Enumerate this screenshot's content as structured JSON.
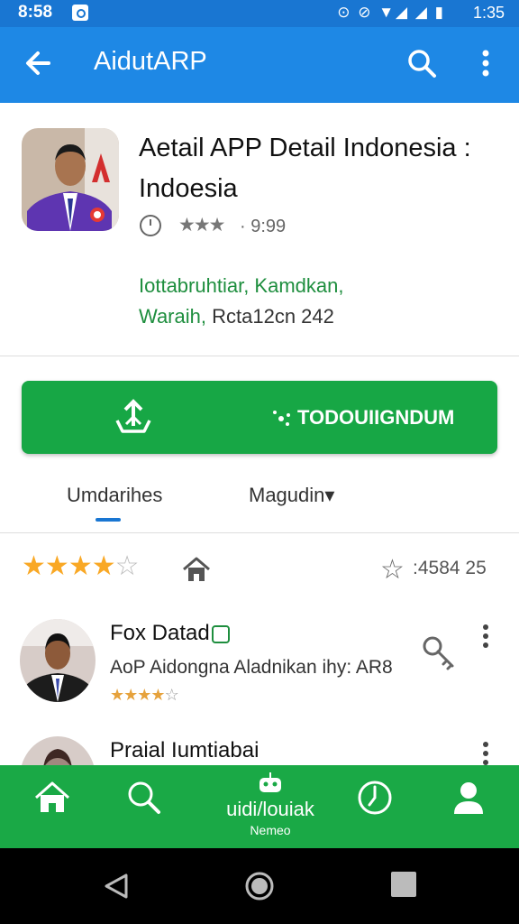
{
  "status_bar": {
    "time": "8:58",
    "time_right": "1:35"
  },
  "app_bar": {
    "title": "AidutARP"
  },
  "app": {
    "name": "Aetail APP Detail Indonesia : Indoesia",
    "rating_text": "· 9:99",
    "developer_line1": "Iottabruhtiar, Kamdkan,",
    "developer_line2_green": "Waraih,",
    "developer_line2_rest": "Rcta12cn 242"
  },
  "install_button": {
    "label": "TODOUIIGNDUM"
  },
  "tabs": [
    {
      "label": "Umdarihes"
    },
    {
      "label": "Magudin▾"
    }
  ],
  "rating_summary": {
    "stars_filled": 4,
    "stars_total": 5,
    "count": ":4584 25"
  },
  "reviews": [
    {
      "name": "Fox Datad",
      "text": "AoP Aidongna Aladnikan ihy: AR8",
      "stars_filled": 4
    },
    {
      "name": "Praial Iumtiabai",
      "text": "",
      "stars_filled": 0
    }
  ],
  "bottom_nav": {
    "center_label": "uidi/louiak",
    "center_sub": "Nemeo"
  },
  "colors": {
    "primary_blue": "#1e88e5",
    "status_blue": "#1976d2",
    "install_green": "#17a745",
    "nav_green": "#1aa946",
    "star_gold": "#f9a825"
  }
}
